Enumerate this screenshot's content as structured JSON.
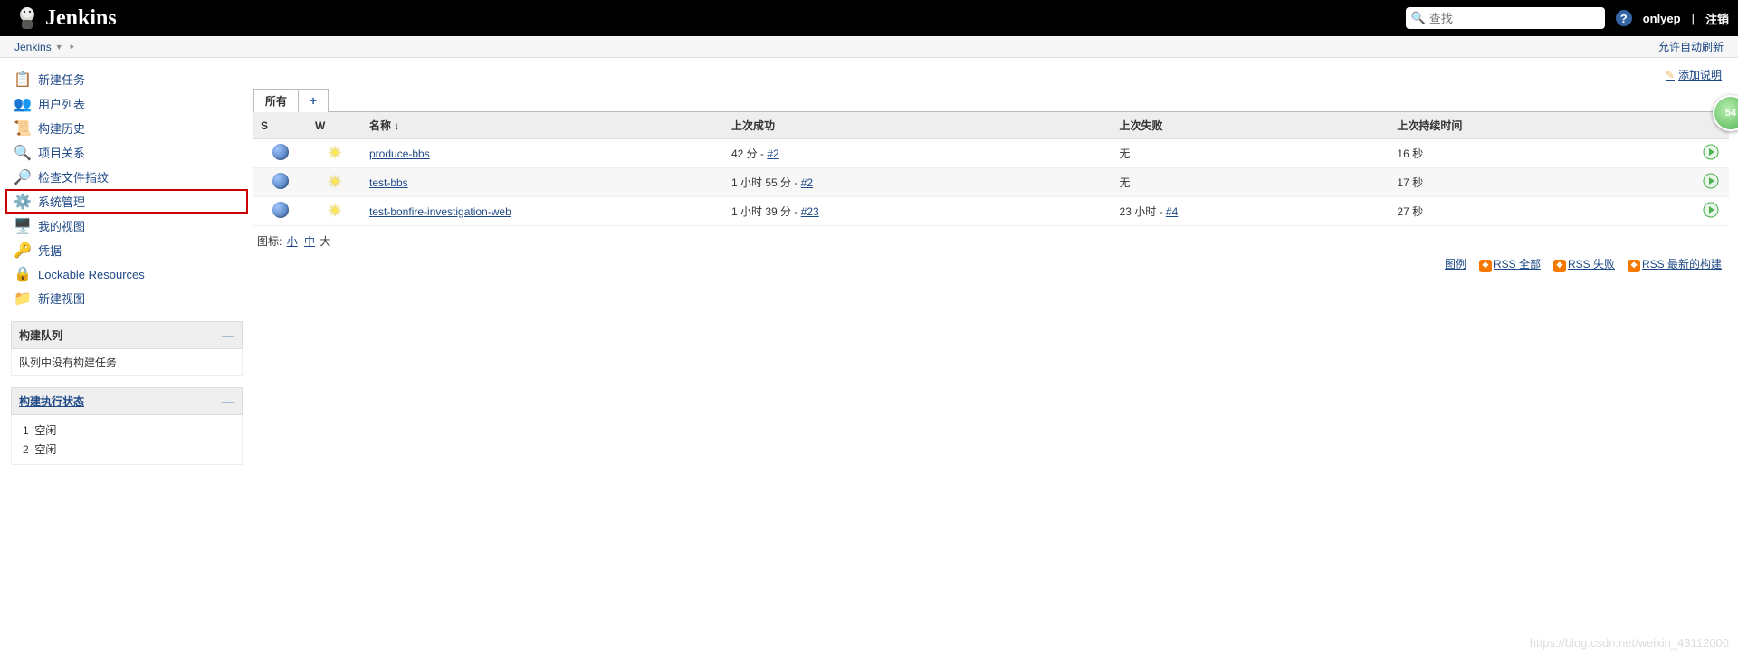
{
  "header": {
    "brand": "Jenkins",
    "search_placeholder": "查找",
    "user": "onlyep",
    "logout": "注销"
  },
  "breadcrumb": {
    "root": "Jenkins",
    "refresh_link": "允许自动刷新"
  },
  "sidebar": {
    "items": [
      {
        "label": "新建任务",
        "icon": "📋"
      },
      {
        "label": "用户列表",
        "icon": "👥"
      },
      {
        "label": "构建历史",
        "icon": "📜"
      },
      {
        "label": "项目关系",
        "icon": "🔍"
      },
      {
        "label": "检查文件指纹",
        "icon": "🔎"
      },
      {
        "label": "系统管理",
        "icon": "⚙️",
        "highlighted": true
      },
      {
        "label": "我的视图",
        "icon": "🖥️"
      },
      {
        "label": "凭据",
        "icon": "🔑"
      },
      {
        "label": "Lockable Resources",
        "icon": "🔒"
      },
      {
        "label": "新建视图",
        "icon": "📁"
      }
    ]
  },
  "queue_box": {
    "title": "构建队列",
    "empty_text": "队列中没有构建任务"
  },
  "executor_box": {
    "title": "构建执行状态",
    "executors": [
      {
        "num": "1",
        "state": "空闲"
      },
      {
        "num": "2",
        "state": "空闲"
      }
    ]
  },
  "main": {
    "add_desc": "添加说明",
    "tabs": {
      "all": "所有",
      "add": "+"
    },
    "columns": {
      "s": "S",
      "w": "W",
      "name": "名称 ↓",
      "last_success": "上次成功",
      "last_failure": "上次失败",
      "last_duration": "上次持续时间"
    },
    "jobs": [
      {
        "name": "produce-bbs",
        "last_success_time": "42 分",
        "last_success_sep": " - ",
        "last_success_build": "#2",
        "last_failure": "无",
        "duration": "16 秒"
      },
      {
        "name": "test-bbs",
        "last_success_time": "1 小时 55 分",
        "last_success_sep": " - ",
        "last_success_build": "#2",
        "last_failure": "无",
        "duration": "17 秒"
      },
      {
        "name": "test-bonfire-investigation-web",
        "last_success_time": "1 小时 39 分",
        "last_success_sep": " - ",
        "last_success_build": "#23",
        "last_failure_time": "23 小时",
        "last_failure_sep": " - ",
        "last_failure_build": "#4",
        "duration": "27 秒"
      }
    ],
    "icon_size": {
      "label": "图标:",
      "small": "小",
      "medium": "中",
      "large": "大"
    },
    "footer": {
      "legend": "图例",
      "rss_all": "RSS 全部",
      "rss_fail": "RSS 失败",
      "rss_latest": "RSS 最新的构建"
    }
  },
  "side_badge": "54",
  "watermark": "https://blog.csdn.net/weixin_43112000"
}
